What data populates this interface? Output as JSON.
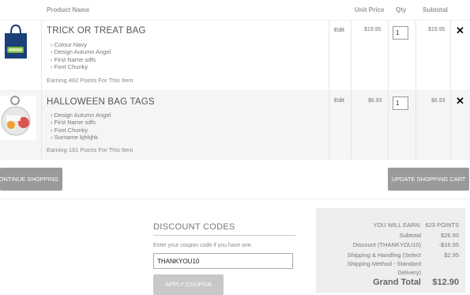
{
  "table": {
    "headers": {
      "product": "Product Name",
      "unit_price": "Unit Price",
      "qty": "Qty",
      "subtotal": "Subtotal"
    },
    "items": [
      {
        "name": "TRICK OR TREAT BAG",
        "options": [
          "Colour  Navy",
          "Design  Autumn Angel",
          "First Name  sdfs",
          "Font  Chunky"
        ],
        "points": "Earning 462 Points For This Item",
        "edit": "Edit",
        "unit_price": "$19.95",
        "qty": "1",
        "subtotal": "$19.95",
        "remove": "✕"
      },
      {
        "name": "HALLOWEEN BAG TAGS",
        "options": [
          "Design  Autumn Angel",
          "First Name  sdfs",
          "Font  Chunky",
          "Surname  kjhkjhk"
        ],
        "points": "Earning 161 Points For This Item",
        "edit": "Edit",
        "unit_price": "$6.93",
        "qty": "1",
        "subtotal": "$6.93",
        "remove": "✕"
      }
    ]
  },
  "actions": {
    "continue": "CONTINUE SHOPPING",
    "update": "UPDATE SHOPPING CART"
  },
  "discount": {
    "title": "DISCOUNT CODES",
    "help": "Enter your coupon code if you have one.",
    "code": "THANKYOU10",
    "apply": "APPLY COUPON"
  },
  "summary": {
    "earn_label": "YOU WILL EARN:",
    "earn_value": "623 POINTS",
    "subtotal_label": "Subtotal",
    "subtotal_value": "$26.90",
    "discount_label": "Discount (THANKYOU10)",
    "discount_value": "-$16.95",
    "shipping_label_1": "Shipping & Handling (Select",
    "shipping_label_2": "Shipping Method - Standard",
    "shipping_label_3": "Delivery)",
    "shipping_value": "$2.95",
    "grand_label": "Grand Total",
    "grand_value": "$12.90"
  },
  "colors": {
    "button_gray": "#9a9a9a",
    "summary_bg": "#eeeeee",
    "row_alt": "#f5f5f5"
  },
  "icons": {
    "remove": "close-icon",
    "bullet": "chevron-right-icon"
  }
}
